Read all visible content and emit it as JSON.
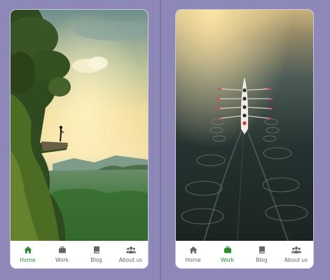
{
  "colors": {
    "background": "#8e88b8",
    "active": "#2e8b2e",
    "inactive": "#666666"
  },
  "screens": [
    {
      "image": "cliff-overlook-photo",
      "active_tab": "Home",
      "nav": [
        {
          "label": "Home",
          "icon": "home-icon"
        },
        {
          "label": "Work",
          "icon": "briefcase-icon"
        },
        {
          "label": "Blog",
          "icon": "book-icon"
        },
        {
          "label": "About us",
          "icon": "people-icon"
        }
      ]
    },
    {
      "image": "rowing-boat-photo",
      "active_tab": "Work",
      "nav": [
        {
          "label": "Home",
          "icon": "home-icon"
        },
        {
          "label": "Work",
          "icon": "briefcase-icon"
        },
        {
          "label": "Blog",
          "icon": "book-icon"
        },
        {
          "label": "About us",
          "icon": "people-icon"
        }
      ]
    }
  ]
}
